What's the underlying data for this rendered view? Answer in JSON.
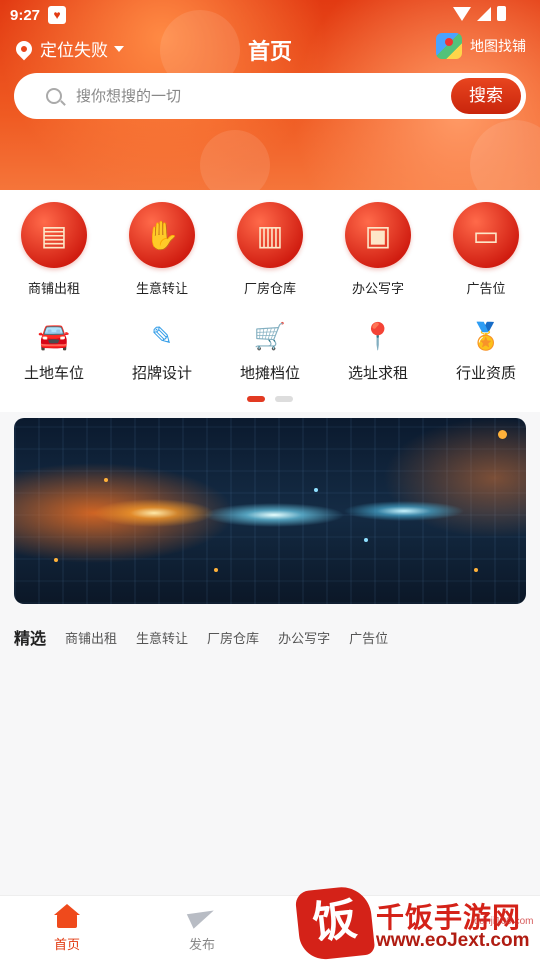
{
  "status_bar": {
    "time": "9:27"
  },
  "header": {
    "location_label": "定位失败",
    "title": "首页",
    "map_label": "地图找铺"
  },
  "search": {
    "placeholder": "搜你想搜的一切",
    "button_label": "搜索"
  },
  "categories_primary": [
    {
      "label": "商铺出租",
      "icon": "storefront-icon"
    },
    {
      "label": "生意转让",
      "icon": "handshake-icon"
    },
    {
      "label": "厂房仓库",
      "icon": "factory-icon"
    },
    {
      "label": "办公写字",
      "icon": "briefcase-icon"
    },
    {
      "label": "广告位",
      "icon": "billboard-icon"
    }
  ],
  "categories_secondary": [
    {
      "label": "土地车位",
      "icon": "car-icon"
    },
    {
      "label": "招牌设计",
      "icon": "ruler-pencil-icon"
    },
    {
      "label": "地摊档位",
      "icon": "cart-icon"
    },
    {
      "label": "选址求租",
      "icon": "location-pin-icon"
    },
    {
      "label": "行业资质",
      "icon": "award-icon"
    }
  ],
  "carousel": {
    "page_count": 2,
    "active_index": 0
  },
  "tabs": {
    "main": "精选",
    "items": [
      "商铺出租",
      "生意转让",
      "厂房仓库",
      "办公写字",
      "广告位"
    ]
  },
  "bottom_nav": {
    "items": [
      {
        "label": "首页",
        "icon": "home-icon",
        "active": true
      },
      {
        "label": "发布",
        "icon": "send-icon",
        "active": false
      }
    ]
  },
  "watermark": {
    "title": "千饭手游网",
    "domain": "www.eoJext.com",
    "sub": "danji100.com"
  },
  "colors": {
    "accent": "#e23a12",
    "header_gradient_top": "#e23a12",
    "header_gradient_bottom": "#f5753a",
    "page_bg": "#f7f7f8"
  }
}
